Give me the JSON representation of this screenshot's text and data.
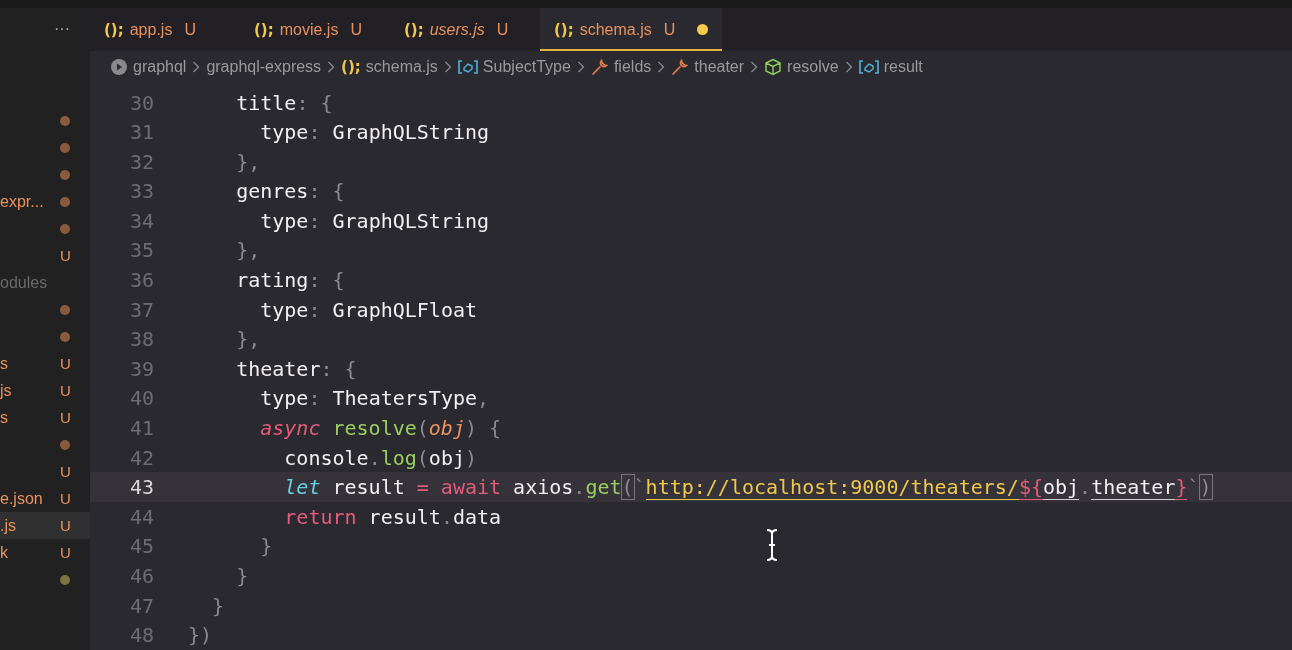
{
  "sidebar": {
    "more": "···",
    "items": [
      {
        "color": "#8a5a3e",
        "ignored": false,
        "selected": false
      },
      {
        "color": "#8a5a3e",
        "ignored": false,
        "selected": false
      },
      {
        "color": "#8a5a3e",
        "ignored": false,
        "selected": false
      },
      {
        "label": "expr...",
        "color": "#8a5a3e",
        "ignored": false,
        "selected": false
      },
      {
        "color": "#8a5a3e",
        "ignored": false,
        "selected": false
      },
      {
        "badge": "U",
        "ignored": false,
        "selected": false
      },
      {
        "label": "odules",
        "ignored": true,
        "selected": false
      },
      {
        "color": "#8a5a3e",
        "ignored": false,
        "selected": false
      },
      {
        "color": "#8a5a3e",
        "ignored": false,
        "selected": false
      },
      {
        "label": "s",
        "badge": "U",
        "ignored": false,
        "selected": false
      },
      {
        "label": "js",
        "badge": "U",
        "ignored": false,
        "selected": false
      },
      {
        "label": "s",
        "badge": "U",
        "ignored": false,
        "selected": false
      },
      {
        "color": "#8a5a3e",
        "ignored": false,
        "selected": false
      },
      {
        "badge": "U",
        "ignored": false,
        "selected": false
      },
      {
        "label": "e.json",
        "badge": "U",
        "ignored": false,
        "selected": false
      },
      {
        "label": ".js",
        "badge": "U",
        "ignored": false,
        "selected": true
      },
      {
        "label": "k",
        "badge": "U",
        "ignored": false,
        "selected": false
      },
      {
        "color": "#7d7340",
        "ignored": false,
        "selected": false
      }
    ]
  },
  "tabs": [
    {
      "icon": "();",
      "label": "app.js",
      "status": "U",
      "preview": false,
      "dirty": false,
      "selected": false
    },
    {
      "icon": "();",
      "label": "movie.js",
      "status": "U",
      "preview": false,
      "dirty": false,
      "selected": false
    },
    {
      "icon": "();",
      "label": "users.js",
      "status": "U",
      "preview": true,
      "dirty": false,
      "selected": false
    },
    {
      "icon": "();",
      "label": "schema.js",
      "status": "U",
      "preview": false,
      "dirty": true,
      "selected": true
    }
  ],
  "breadcrumbs": [
    {
      "kind": "root",
      "label": "graphql"
    },
    {
      "kind": "folder",
      "label": "graphql-express"
    },
    {
      "kind": "file",
      "label": "schema.js",
      "icon": "();"
    },
    {
      "kind": "variable",
      "label": "SubjectType"
    },
    {
      "kind": "field",
      "label": "fields"
    },
    {
      "kind": "field",
      "label": "theater"
    },
    {
      "kind": "method",
      "label": "resolve"
    },
    {
      "kind": "variable",
      "label": "result"
    }
  ],
  "code": [
    {
      "number": "30",
      "current": false,
      "tokens": [
        {
          "kind": "id",
          "text": "    title"
        },
        {
          "kind": "punct",
          "text": ": {"
        }
      ]
    },
    {
      "number": "31",
      "current": false,
      "tokens": [
        {
          "kind": "id",
          "text": "      type"
        },
        {
          "kind": "punct",
          "text": ": "
        },
        {
          "kind": "id",
          "text": "GraphQLString"
        }
      ]
    },
    {
      "number": "32",
      "current": false,
      "tokens": [
        {
          "kind": "punct",
          "text": "    },"
        }
      ]
    },
    {
      "number": "33",
      "current": false,
      "tokens": [
        {
          "kind": "id",
          "text": "    genres"
        },
        {
          "kind": "punct",
          "text": ": {"
        }
      ]
    },
    {
      "number": "34",
      "current": false,
      "tokens": [
        {
          "kind": "id",
          "text": "      type"
        },
        {
          "kind": "punct",
          "text": ": "
        },
        {
          "kind": "id",
          "text": "GraphQLString"
        }
      ]
    },
    {
      "number": "35",
      "current": false,
      "tokens": [
        {
          "kind": "punct",
          "text": "    },"
        }
      ]
    },
    {
      "number": "36",
      "current": false,
      "tokens": [
        {
          "kind": "id",
          "text": "    rating"
        },
        {
          "kind": "punct",
          "text": ": {"
        }
      ]
    },
    {
      "number": "37",
      "current": false,
      "tokens": [
        {
          "kind": "id",
          "text": "      type"
        },
        {
          "kind": "punct",
          "text": ": "
        },
        {
          "kind": "id",
          "text": "GraphQLFloat"
        }
      ]
    },
    {
      "number": "38",
      "current": false,
      "tokens": [
        {
          "kind": "punct",
          "text": "    },"
        }
      ]
    },
    {
      "number": "39",
      "current": false,
      "tokens": [
        {
          "kind": "id",
          "text": "    theater"
        },
        {
          "kind": "punct",
          "text": ": {"
        }
      ]
    },
    {
      "number": "40",
      "current": false,
      "tokens": [
        {
          "kind": "id",
          "text": "      type"
        },
        {
          "kind": "punct",
          "text": ": "
        },
        {
          "kind": "id",
          "text": "TheatersType"
        },
        {
          "kind": "punct",
          "text": ","
        }
      ]
    },
    {
      "number": "41",
      "current": false,
      "tokens": [
        {
          "kind": "keyword",
          "text": "      async"
        },
        {
          "kind": "func",
          "text": " resolve"
        },
        {
          "kind": "punct",
          "text": "("
        },
        {
          "kind": "param",
          "text": "obj"
        },
        {
          "kind": "punct",
          "text": ") {"
        }
      ]
    },
    {
      "number": "42",
      "current": false,
      "tokens": [
        {
          "kind": "id",
          "text": "        console"
        },
        {
          "kind": "punct",
          "text": "."
        },
        {
          "kind": "func",
          "text": "log"
        },
        {
          "kind": "punct",
          "text": "("
        },
        {
          "kind": "id",
          "text": "obj"
        },
        {
          "kind": "punct",
          "text": ")"
        }
      ]
    },
    {
      "number": "43",
      "current": true,
      "tokens": [
        {
          "kind": "storage",
          "text": "        let"
        },
        {
          "kind": "id",
          "text": " result "
        },
        {
          "kind": "op",
          "text": "= await"
        },
        {
          "kind": "id",
          "text": " axios"
        },
        {
          "kind": "punct",
          "text": "."
        },
        {
          "kind": "func",
          "text": "get"
        },
        {
          "kind": "match",
          "text": "("
        },
        {
          "kind": "punct",
          "text": "`"
        },
        {
          "kind": "string",
          "text": "http://localhost:9000/theaters/"
        },
        {
          "kind": "interp",
          "text": "${"
        },
        {
          "kind": "ref",
          "text": "obj"
        },
        {
          "kind": "punct",
          "text": "."
        },
        {
          "kind": "ref",
          "text": "theater"
        },
        {
          "kind": "interp",
          "text": "}"
        },
        {
          "kind": "punct",
          "text": "`"
        },
        {
          "kind": "match",
          "text": ")"
        }
      ]
    },
    {
      "number": "44",
      "current": false,
      "tokens": [
        {
          "kind": "op",
          "text": "        return"
        },
        {
          "kind": "id",
          "text": " result"
        },
        {
          "kind": "punct",
          "text": "."
        },
        {
          "kind": "id",
          "text": "data"
        }
      ]
    },
    {
      "number": "45",
      "current": false,
      "tokens": [
        {
          "kind": "punct",
          "text": "      }"
        }
      ]
    },
    {
      "number": "46",
      "current": false,
      "tokens": [
        {
          "kind": "punct",
          "text": "    }"
        }
      ]
    },
    {
      "number": "47",
      "current": false,
      "tokens": [
        {
          "kind": "punct",
          "text": "  }"
        }
      ]
    },
    {
      "number": "48",
      "current": false,
      "tokens": [
        {
          "kind": "punct",
          "text": "})"
        }
      ]
    }
  ]
}
